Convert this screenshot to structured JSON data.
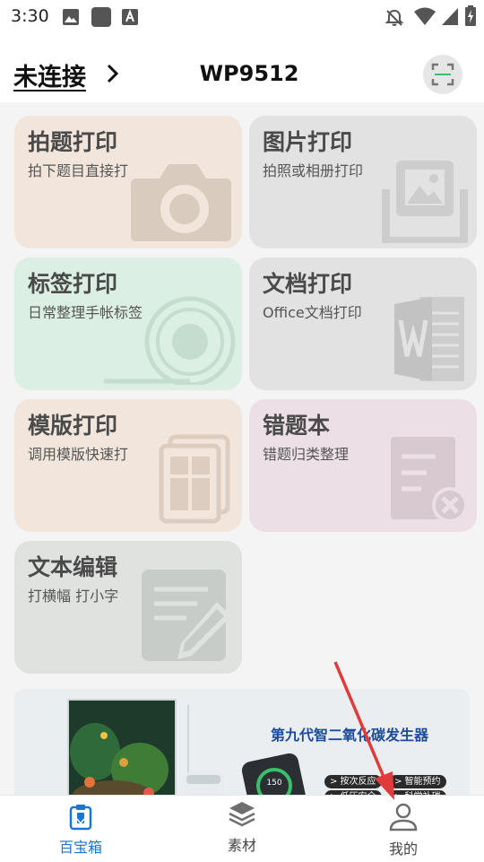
{
  "status_bar": {
    "time": "3:30"
  },
  "header": {
    "connection_status": "未连接",
    "device_name": "WP9512"
  },
  "cards": [
    {
      "title": "拍题打印",
      "subtitle": "拍下题目直接打",
      "icon": "camera-icon",
      "bg": "#f2e6dc"
    },
    {
      "title": "图片打印",
      "subtitle": "拍照或相册打印",
      "icon": "photo-print-icon",
      "bg": "#e2e2e2"
    },
    {
      "title": "标签打印",
      "subtitle": "日常整理手帐标签",
      "icon": "tape-roll-icon",
      "bg": "#dcefe4"
    },
    {
      "title": "文档打印",
      "subtitle": "Office文档打印",
      "icon": "word-doc-icon",
      "bg": "#e2e2e2"
    },
    {
      "title": "模版打印",
      "subtitle": "调用模版快速打",
      "icon": "template-icon",
      "bg": "#f2e6dc"
    },
    {
      "title": "错题本",
      "subtitle": "错题归类整理",
      "icon": "wrong-notebook-icon",
      "bg": "#ece0e6"
    },
    {
      "title": "文本编辑",
      "subtitle": "打横幅 打小字",
      "icon": "edit-text-icon",
      "bg": "#dfe2df"
    }
  ],
  "banner": {
    "headline": "第九代智二氧化碳发生器",
    "tags": [
      "> 按次反应",
      "> 智能预约",
      "> 低压安全",
      "> 科学补碳"
    ],
    "gauge_value": "150"
  },
  "nav": [
    {
      "label": "百宝箱",
      "icon": "toolbox-icon",
      "active": true
    },
    {
      "label": "素材",
      "icon": "layers-icon",
      "active": false
    },
    {
      "label": "我的",
      "icon": "user-icon",
      "active": false
    }
  ],
  "colors": {
    "accent": "#1976d2",
    "card_title": "#4a4a4a",
    "arrow": "#e03a3a",
    "banner_headline": "#1c4b9b"
  }
}
